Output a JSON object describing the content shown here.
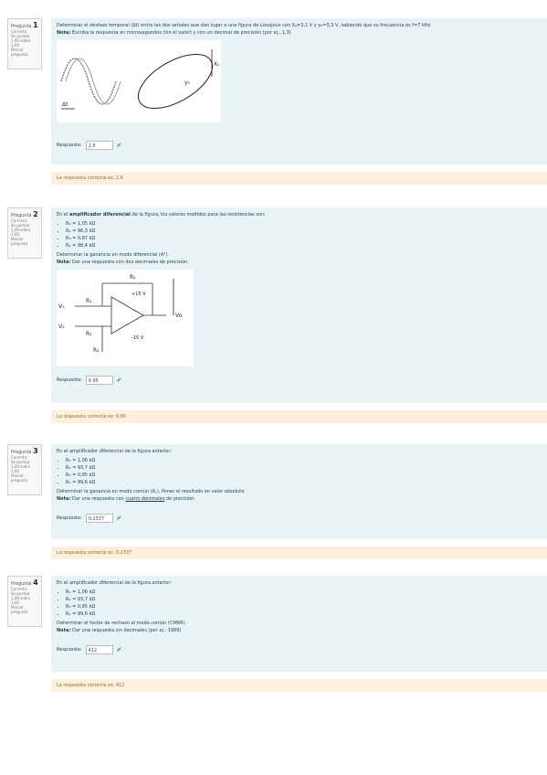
{
  "questions": [
    {
      "label": "Pregunta",
      "number": "1",
      "status": "Correcta",
      "score": "Se puntúa 1,00 sobre 1,00",
      "flag": "Marcar pregunta",
      "text": "Determinar el desfase temporal (Δt) entre las dos señales que dan lugar a una figura de Lissajous con X₀=3,1 V y y₀=5,3 V, sabiendo que su frecuencia es f=7 kHz.",
      "note_label": "Nota:",
      "note": "Escriba la respuesta en microsegundos (sin el valor) y con un decimal de precisión (por ej.: 1,3)",
      "answer_label": "Respuesta:",
      "answer_value": "2,6",
      "feedback": "La respuesta correcta es: 2,6",
      "fig_labels": [
        "Δt",
        "X₀",
        "y₀"
      ]
    },
    {
      "label": "Pregunta",
      "number": "2",
      "status": "Correcta",
      "score": "Se puntúa 1,00 sobre 1,00",
      "flag": "Marcar pregunta",
      "text_prefix": "En el",
      "text_bold": "amplificador diferencial",
      "text_suffix": "de la figura, los valores medidos para las resistencias son:",
      "items": [
        "R₁ = 1,05 kΩ",
        "R₂ = 96,3 kΩ",
        "R₃ = 0,97 kΩ",
        "R₄ = 98,4 kΩ"
      ],
      "question": "Determinar la ganancia en modo diferencial (Aᵈ).",
      "note_label": "Nota:",
      "note": "Dar una respuesta con dos decimales de precisión.",
      "answer_label": "Respuesta:",
      "answer_value": "9,95",
      "feedback": "La respuesta correcta es: 9,95",
      "fig_labels": [
        "R₂",
        "R₁",
        "R₃",
        "R₄",
        "V₁",
        "V₂",
        "Vo",
        "+15 V",
        "-15 V"
      ]
    },
    {
      "label": "Pregunta",
      "number": "3",
      "status": "Correcta",
      "score": "Se puntúa 1,00 sobre 1,00",
      "flag": "Marcar pregunta",
      "text": "En el amplificador diferencial de la figura anterior:",
      "items": [
        "R₁ = 1,06 kΩ",
        "R₂ = 93,7 kΩ",
        "R₃ = 0,95 kΩ",
        "R₄ = 99,6 kΩ"
      ],
      "question": "Determinar la ganancia en modo común (A꜀). Poner el resultado en valor absoluto.",
      "note_label": "Nota:",
      "note_prefix": "Dar una respuesta con",
      "note_u": "cuatro decimales",
      "note_suffix": "de precisión.",
      "answer_label": "Respuesta:",
      "answer_value": "0,2337",
      "feedback": "La respuesta correcta es: 0,2337"
    },
    {
      "label": "Pregunta",
      "number": "4",
      "status": "Correcta",
      "score": "Se puntúa 1,00 sobre 1,00",
      "flag": "Marcar pregunta",
      "text": "En el amplificador diferencial de la figura anterior:",
      "items": [
        "R₁ = 1,06 kΩ",
        "R₂ = 93,7 kΩ",
        "R₃ = 0,95 kΩ",
        "R₄ = 99,6 kΩ"
      ],
      "question": "Determinar el factor de rechazo al modo común (CMRR).",
      "note_label": "Nota:",
      "note": "Dar una respuesta sin decimales (por ej.: 1989)",
      "answer_label": "Respuesta:",
      "answer_value": "412",
      "feedback": "La respuesta correcta es: 412"
    }
  ]
}
